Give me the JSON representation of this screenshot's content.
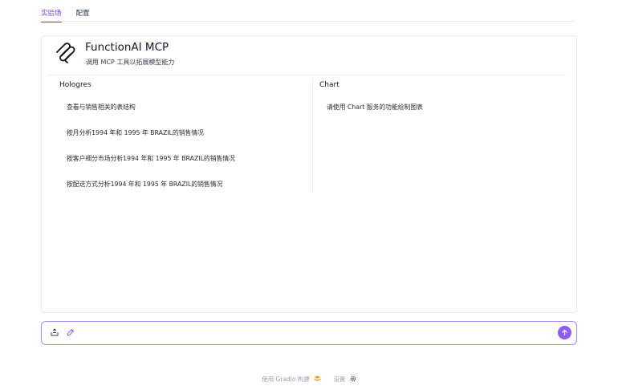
{
  "tabs": [
    {
      "label": "实验场",
      "active": true
    },
    {
      "label": "配置",
      "active": false
    }
  ],
  "header": {
    "title": "FunctionAI MCP",
    "subtitle": "调用 MCP 工具以拓展模型能力"
  },
  "columns": [
    {
      "title": "Hologres",
      "prompts": [
        "查看与销售相关的表结构",
        "按月分析1994 年和 1995 年 BRAZIL的销售情况",
        "按客户细分市场分析1994 年和 1995 年 BRAZIL的销售情况",
        "按配送方式分析1994 年和 1995 年 BRAZIL的销售情况"
      ]
    },
    {
      "title": "Chart",
      "prompts": [
        "请使用 Chart 服务的功能绘制图表"
      ]
    }
  ],
  "input": {
    "placeholder": "",
    "accent": "#8b5cf6"
  },
  "footer": {
    "built_with": "使用 Gradio 构建",
    "sep": "·",
    "settings": "设置"
  }
}
